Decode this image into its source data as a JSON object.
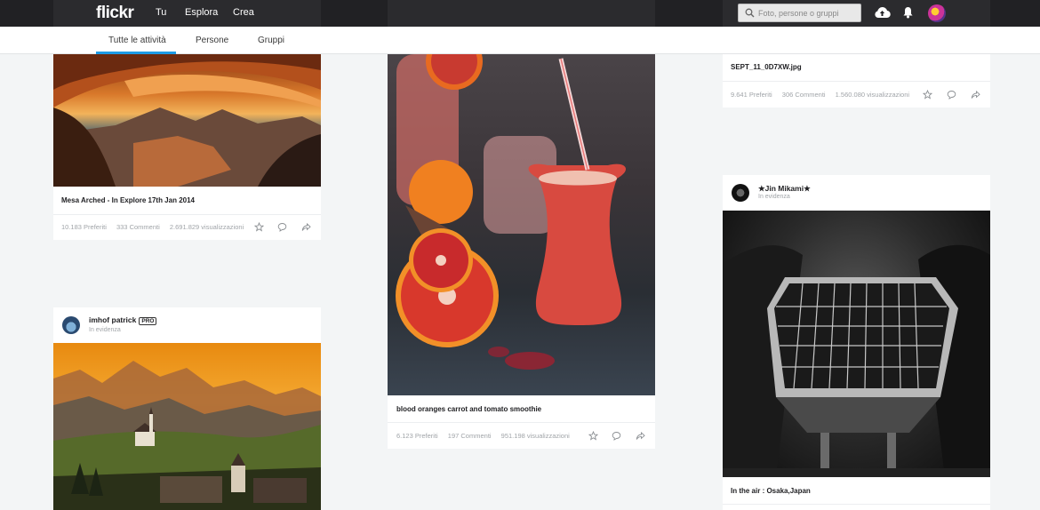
{
  "header": {
    "logo": "flickr",
    "nav": [
      "Tu",
      "Esplora",
      "Crea"
    ],
    "search_placeholder": "Foto, persone o gruppi",
    "icons": [
      "upload-icon",
      "bell-icon",
      "user-avatar"
    ]
  },
  "tabs": [
    {
      "label": "Tutte le attività",
      "active": true
    },
    {
      "label": "Persone",
      "active": false
    },
    {
      "label": "Gruppi",
      "active": false
    }
  ],
  "cards": {
    "mesa": {
      "caption": "Mesa Arched - In Explore 17th Jan 2014",
      "stats": [
        "10.183 Preferiti",
        "333 Commenti",
        "2.691.829 visualizzazioni"
      ]
    },
    "imhof": {
      "user": "imhof patrick",
      "badge": "PRO",
      "sub": "In evidenza"
    },
    "smoothie": {
      "caption": "blood oranges carrot and tomato smoothie",
      "stats": [
        "6.123 Preferiti",
        "197 Commenti",
        "951.198 visualizzazioni"
      ]
    },
    "sept": {
      "caption": "SEPT_11_0D7XW.jpg",
      "stats": [
        "9.641 Preferiti",
        "306 Commenti",
        "1.560.080 visualizzazioni"
      ]
    },
    "jin": {
      "user": "★Jin Mikami★",
      "sub": "In evidenza",
      "caption": "In the air : Osaka,Japan"
    }
  },
  "colors": {
    "topbar": "#212124",
    "accent": "#1c9be6",
    "background": "#f3f5f6"
  }
}
